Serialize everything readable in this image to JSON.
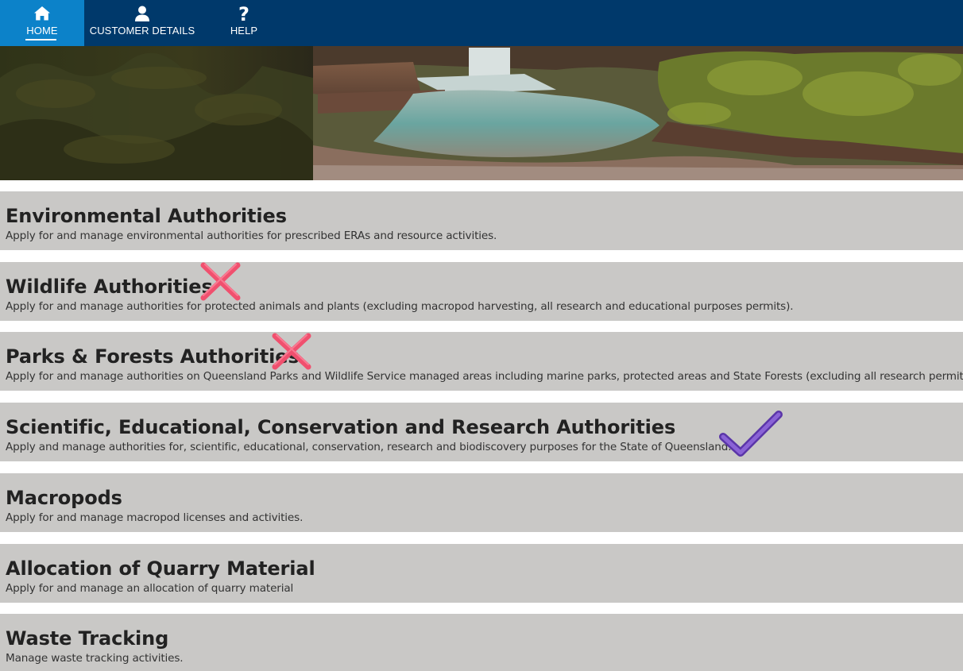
{
  "nav": {
    "items": [
      {
        "label": "HOME",
        "icon": "home-icon",
        "active": true
      },
      {
        "label": "CUSTOMER DETAILS",
        "icon": "user-icon",
        "active": false
      },
      {
        "label": "HELP",
        "icon": "question-icon",
        "active": false
      }
    ]
  },
  "colors": {
    "nav_bg": "#00396b",
    "nav_active": "#0c82c9",
    "card_bg": "#c9c8c6",
    "cross_mark": "#f0506e",
    "check_mark": "#7b4fc8"
  },
  "cards": [
    {
      "title": "Environmental Authorities",
      "desc": "Apply for and manage environmental authorities for prescribed ERAs and resource activities."
    },
    {
      "title": "Wildlife Authorities",
      "desc": "Apply for and manage authorities for protected animals and plants (excluding macropod harvesting, all research and educational purposes permits)."
    },
    {
      "title": "Parks & Forests Authorities",
      "desc": "Apply for and manage authorities on Queensland Parks and Wildlife Service managed areas including marine parks, protected areas and State Forests (excluding all research permits)."
    },
    {
      "title": "Scientific, Educational, Conservation and Research Authorities",
      "desc": "Apply and manage authorities for, scientific, educational, conservation, research and biodiscovery purposes for the State of Queensland."
    },
    {
      "title": "Macropods",
      "desc": "Apply for and manage macropod licenses and activities."
    },
    {
      "title": "Allocation of Quarry Material",
      "desc": "Apply for and manage an allocation of quarry material"
    },
    {
      "title": "Waste Tracking",
      "desc": "Manage waste tracking activities."
    }
  ],
  "annotations": [
    {
      "type": "cross-icon",
      "card": "Wildlife Authorities"
    },
    {
      "type": "cross-icon",
      "card": "Parks & Forests Authorities"
    },
    {
      "type": "check-icon",
      "card": "Scientific, Educational, Conservation and Research Authorities"
    }
  ]
}
